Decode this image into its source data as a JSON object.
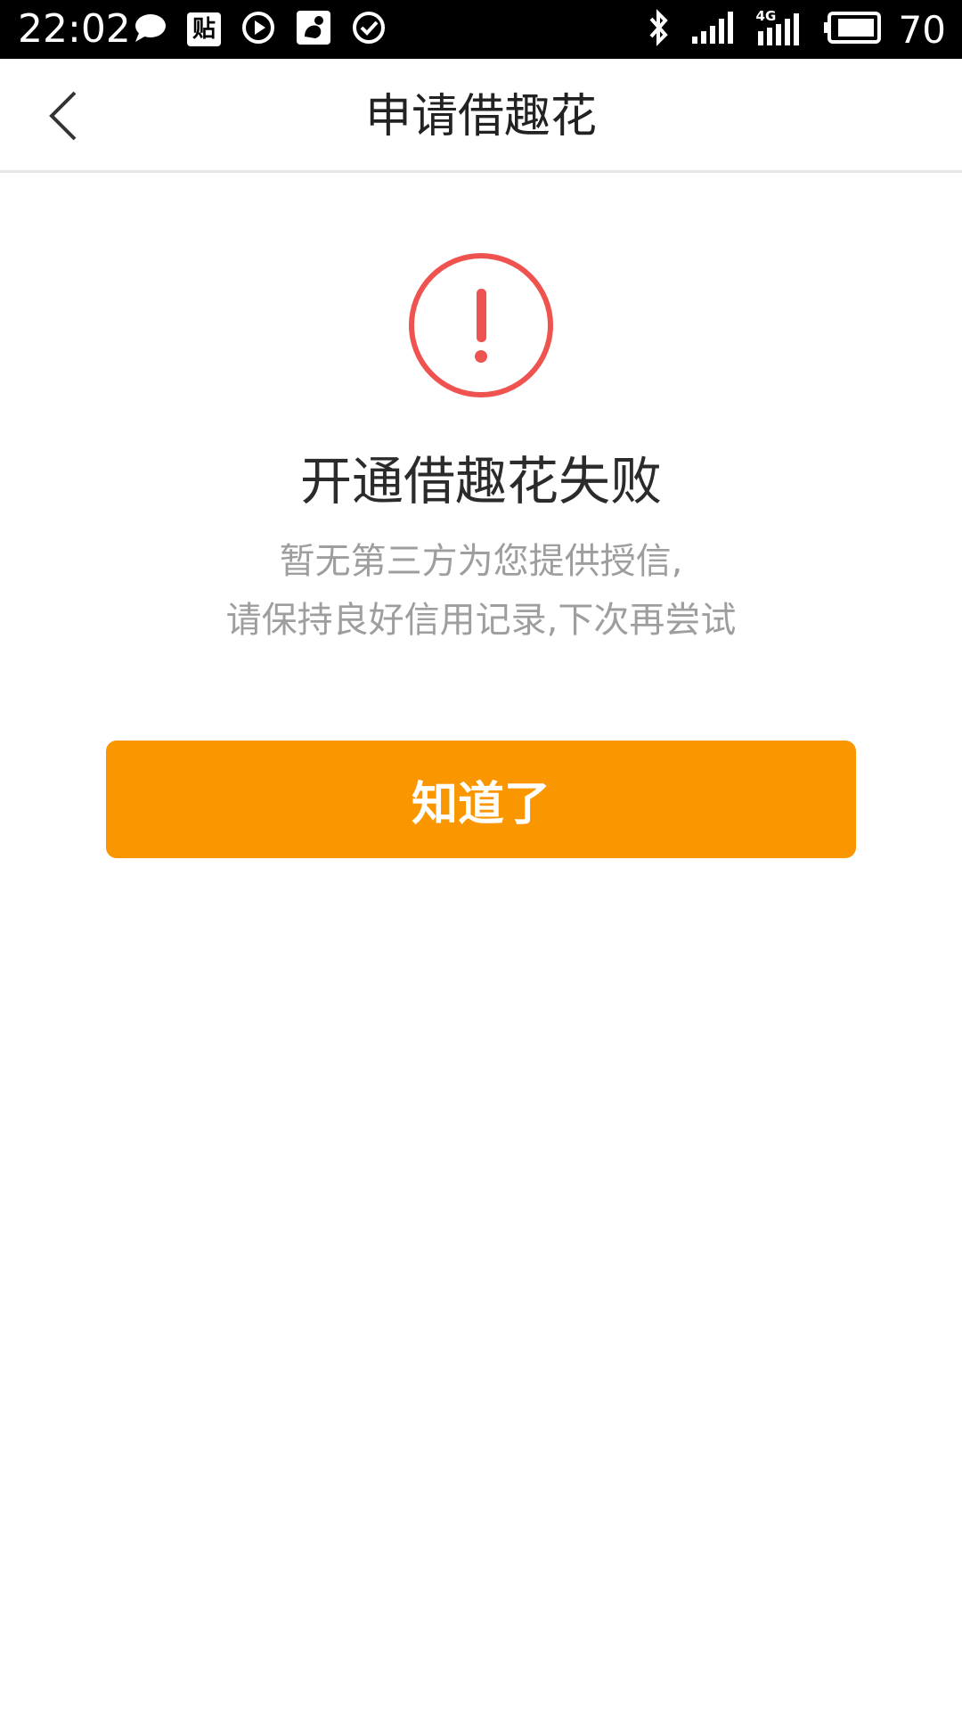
{
  "status_bar": {
    "time": "22:02",
    "left_icons": [
      "chat-bubble-icon",
      "tieba-icon",
      "play-icon",
      "squirrel-icon",
      "check-circle-icon"
    ],
    "tieba_label": "贴",
    "network_label": "4G",
    "battery_level": "70"
  },
  "nav": {
    "title": "申请借趣花"
  },
  "result": {
    "icon": "exclamation-circle-icon",
    "title": "开通借趣花失败",
    "desc_line1": "暂无第三方为您提供授信,",
    "desc_line2": "请保持良好信用记录,下次再尝试"
  },
  "actions": {
    "ok_label": "知道了"
  },
  "colors": {
    "accent": "#fa9600",
    "alert": "#ef5350",
    "title_text": "#2b2b2b",
    "secondary_text": "#9e9e9e"
  }
}
